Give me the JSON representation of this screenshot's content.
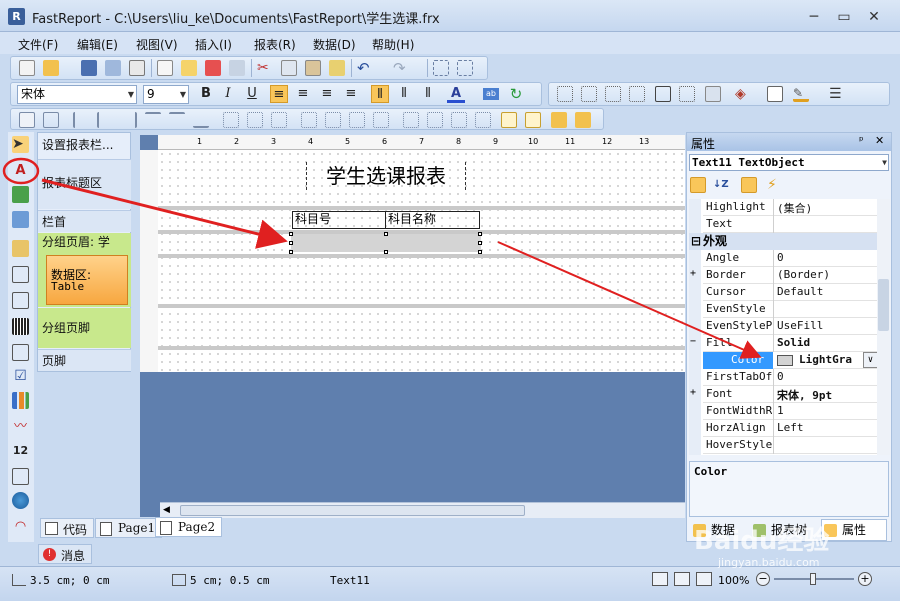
{
  "window": {
    "app_icon": "R",
    "title": "FastReport - C:\\Users\\liu_ke\\Documents\\FastReport\\学生选课.frx",
    "minimize": "─",
    "maximize": "▭",
    "close": "✕"
  },
  "menu": [
    "文件(F)",
    "编辑(E)",
    "视图(V)",
    "插入(I)",
    "报表(R)",
    "数据(D)",
    "帮助(H)"
  ],
  "format_toolbar": {
    "font_name": "宋体",
    "font_size": "9",
    "bold": "B",
    "italic": "I",
    "underline": "U"
  },
  "band_tree": {
    "header_label": "设置报表栏...",
    "report_title": "报表标题区",
    "column_header": "栏首",
    "group_header": "分组页眉: 学",
    "data_band": "数据区:",
    "data_band_source": "Table",
    "group_footer": "分组页脚",
    "page_footer": "页脚"
  },
  "ruler_numbers": [
    "1",
    "2",
    "3",
    "4",
    "5",
    "6",
    "7",
    "8",
    "9",
    "10",
    "11",
    "12",
    "13"
  ],
  "report": {
    "title_text": "学生选课报表",
    "col1_header": "科目号",
    "col2_header": "科目名称"
  },
  "tabs": {
    "code": "代码",
    "page1": "Page1",
    "page2": "Page2",
    "messages": "消息"
  },
  "properties": {
    "panel_title": "属性",
    "pin": "ᵖ",
    "close": "✕",
    "object_selector": "Text11 TextObject",
    "rows": [
      {
        "name": "Highlight",
        "value": "(集合)"
      },
      {
        "name": "Text",
        "value": ""
      },
      {
        "name": "外观",
        "value": "",
        "category": true
      },
      {
        "name": "Angle",
        "value": "0"
      },
      {
        "name": "Border",
        "value": "(Border)",
        "expand": "+"
      },
      {
        "name": "Cursor",
        "value": "Default"
      },
      {
        "name": "EvenStyle",
        "value": ""
      },
      {
        "name": "EvenStylePr",
        "value": "UseFill"
      },
      {
        "name": "Fill",
        "value": "Solid",
        "expand": "−",
        "bold": true
      },
      {
        "name": "Color",
        "value": "LightGra",
        "selected": true,
        "bold": true
      },
      {
        "name": "FirstTabOff",
        "value": "0"
      },
      {
        "name": "Font",
        "value": "宋体, 9pt",
        "expand": "+",
        "bold": true
      },
      {
        "name": "FontWidthRe",
        "value": "1"
      },
      {
        "name": "HorzAlign",
        "value": "Left"
      },
      {
        "name": "HoverStyle",
        "value": ""
      }
    ],
    "description_title": "Color",
    "tab_data": "数据",
    "tab_report_tree": "报表树",
    "tab_properties": "属性"
  },
  "status": {
    "position": "3.5 cm; 0 cm",
    "size": "5 cm; 0.5 cm",
    "object": "Text11",
    "zoom": "100%"
  },
  "watermark": {
    "brand": "Baidu经验",
    "url": "jingyan.baidu.com"
  },
  "colors": {
    "selected_row": "#3399ff",
    "annotation_red": "#e02020",
    "data_band": "#f7a740",
    "group_band": "#c8e88c"
  }
}
